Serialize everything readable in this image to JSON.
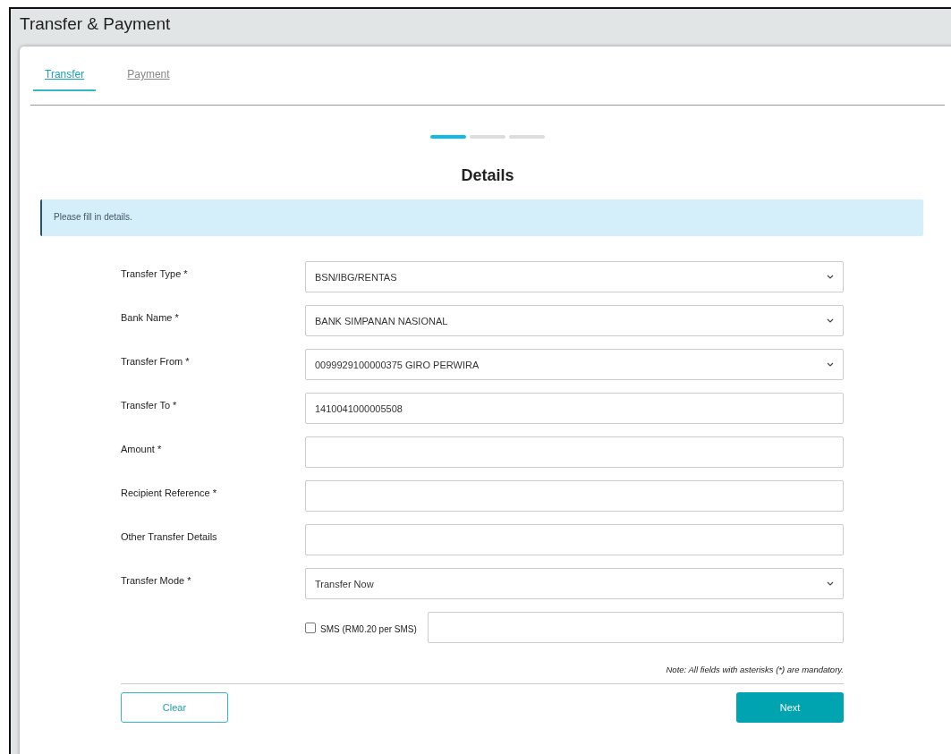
{
  "window": {
    "title": "Transfer & Payment"
  },
  "tabs": [
    {
      "label": "Transfer",
      "selected": true
    },
    {
      "label": "Payment",
      "selected": false
    }
  ],
  "steps": [
    {
      "selected": true
    },
    {
      "selected": false
    },
    {
      "selected": false
    }
  ],
  "heading": "Details",
  "info": "Please fill in details.",
  "fields": [
    {
      "kind": "select",
      "label": "Transfer Type *",
      "value": "BSN/IBG/RENTAS"
    },
    {
      "kind": "select",
      "label": "Bank Name *",
      "value": "BANK SIMPANAN NASIONAL"
    },
    {
      "kind": "select",
      "label": "Transfer From *",
      "value": "0099929100000375 GIRO PERWIRA"
    },
    {
      "kind": "text",
      "label": "Transfer To *",
      "value": "1410041000005508"
    },
    {
      "kind": "text",
      "label": "Amount *"
    },
    {
      "kind": "text",
      "label": "Recipient Reference *"
    },
    {
      "kind": "text",
      "label": "Other Transfer Details"
    },
    {
      "kind": "select",
      "label": "Transfer Mode *",
      "value": "Transfer Now"
    }
  ],
  "sms": {
    "label": "SMS (RM0.20 per SMS)",
    "checked": false
  },
  "note": "Note: All fields with asterisks (*) are mandatory.",
  "buttons": [
    {
      "kind": "secondary",
      "label": "Clear"
    },
    {
      "kind": "primary",
      "label": "Next"
    }
  ]
}
